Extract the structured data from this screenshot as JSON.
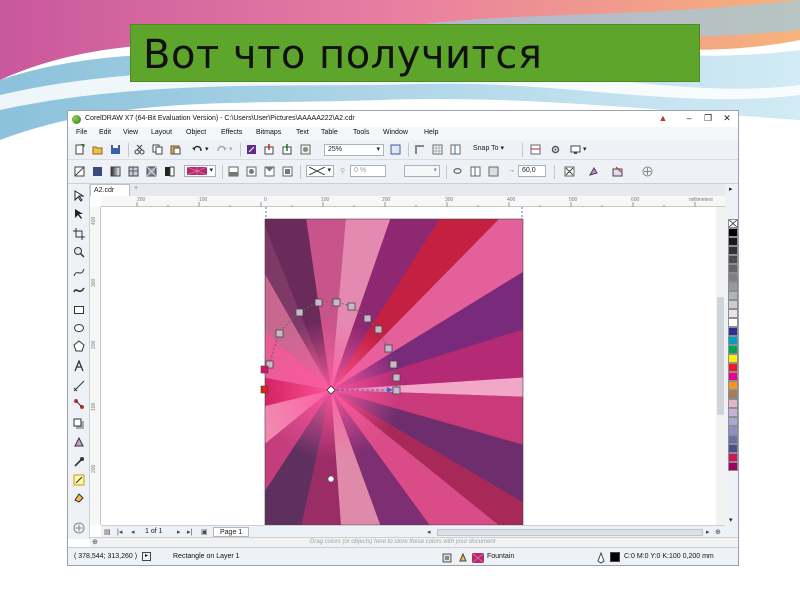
{
  "slide": {
    "title": "Вот что получится",
    "colors": {
      "title_bg": "#5ea62b",
      "wave_pink": "#c9579d",
      "wave_blue": "#9ccce0"
    }
  },
  "app": {
    "title": "CorelDRAW X7 (64-Bit Evaluation Version) - C:\\Users\\User\\Pictures\\AAAAA222\\A2.cdr",
    "window_controls": [
      "minimize",
      "restore",
      "close"
    ]
  },
  "menu": [
    "File",
    "Edit",
    "View",
    "Layout",
    "Object",
    "Effects",
    "Bitmaps",
    "Text",
    "Table",
    "Tools",
    "Window",
    "Help"
  ],
  "toolbar": {
    "zoom": "25%",
    "snap_to": "Snap To",
    "transparency": "0 %",
    "angle": "60,0",
    "fill_color": "#b5296e"
  },
  "document": {
    "tab": "A2.cdr",
    "ruler_units": "millimeters",
    "h_ruler_labels": [
      "200",
      "100",
      "0",
      "100",
      "200",
      "300",
      "400",
      "500",
      "600"
    ],
    "v_ruler_labels": [
      "400",
      "300",
      "200",
      "100",
      "200"
    ]
  },
  "gradient": {
    "type": "conical",
    "colors": [
      "#c41f63",
      "#e8589b",
      "#f08fb5",
      "#7a2a78",
      "#4a2d5e",
      "#b02142",
      "#d84e7d",
      "#fcd8e6"
    ]
  },
  "palette": [
    "#ffffff",
    "#000000",
    "#1a1a1a",
    "#333333",
    "#4d4d4d",
    "#666666",
    "#808080",
    "#999999",
    "#b3b3b3",
    "#cccccc",
    "#e6e6e6",
    "#ffffff",
    "#2e3192",
    "#00a0c6",
    "#00a651",
    "#fff200",
    "#ed1c24",
    "#ec008c",
    "#f7941d",
    "#a67c52",
    "#e5b4c4",
    "#c7b2d6",
    "#a7a9d4",
    "#8e8fc2",
    "#6d6ea8",
    "#4d4f8c",
    "#d4145a",
    "#9e005d"
  ],
  "pagebar": {
    "page_count": "1 of 1",
    "page_tab": "Page 1"
  },
  "colorbar": {
    "hint": "Drag colors (or objects) here to store these colors with your document"
  },
  "status": {
    "coords": "( 378,544; 313,260 )",
    "object": "Rectangle on Layer 1",
    "fill": "Fountain",
    "outline": "C:0 M:0 Y:0 K:100  0,200 mm"
  }
}
